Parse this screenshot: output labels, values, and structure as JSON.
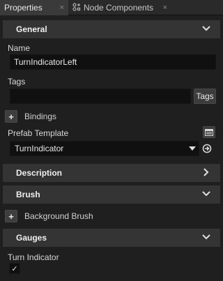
{
  "tabs": [
    {
      "label": "Properties",
      "icon": "",
      "close": "×"
    },
    {
      "label": "Node Components",
      "icon": "⚙",
      "close": "×"
    }
  ],
  "sections": {
    "general": "General",
    "description": "Description",
    "brush": "Brush",
    "gauges": "Gauges"
  },
  "fields": {
    "name_label": "Name",
    "name_value": "TurnIndicatorLeft",
    "tags_label": "Tags",
    "tags_value": "",
    "tags_button": "Tags",
    "bindings_label": "Bindings",
    "prefab_label": "Prefab Template",
    "prefab_value": "TurnIndicator",
    "background_brush_label": "Background Brush",
    "turn_indicator_label": "Turn Indicator",
    "turn_indicator_checked": "✓"
  },
  "icons": {
    "plus": "+",
    "chevron_down": "chevron-down-icon",
    "chevron_right": "chevron-right-icon",
    "prefab_edit": "window-icon",
    "prefab_goto": "goto-arrow-icon"
  },
  "colors": {
    "background": "#1f1f1f",
    "section_header": "#343434",
    "field_bg": "#101010",
    "text": "#d8d8d8"
  }
}
